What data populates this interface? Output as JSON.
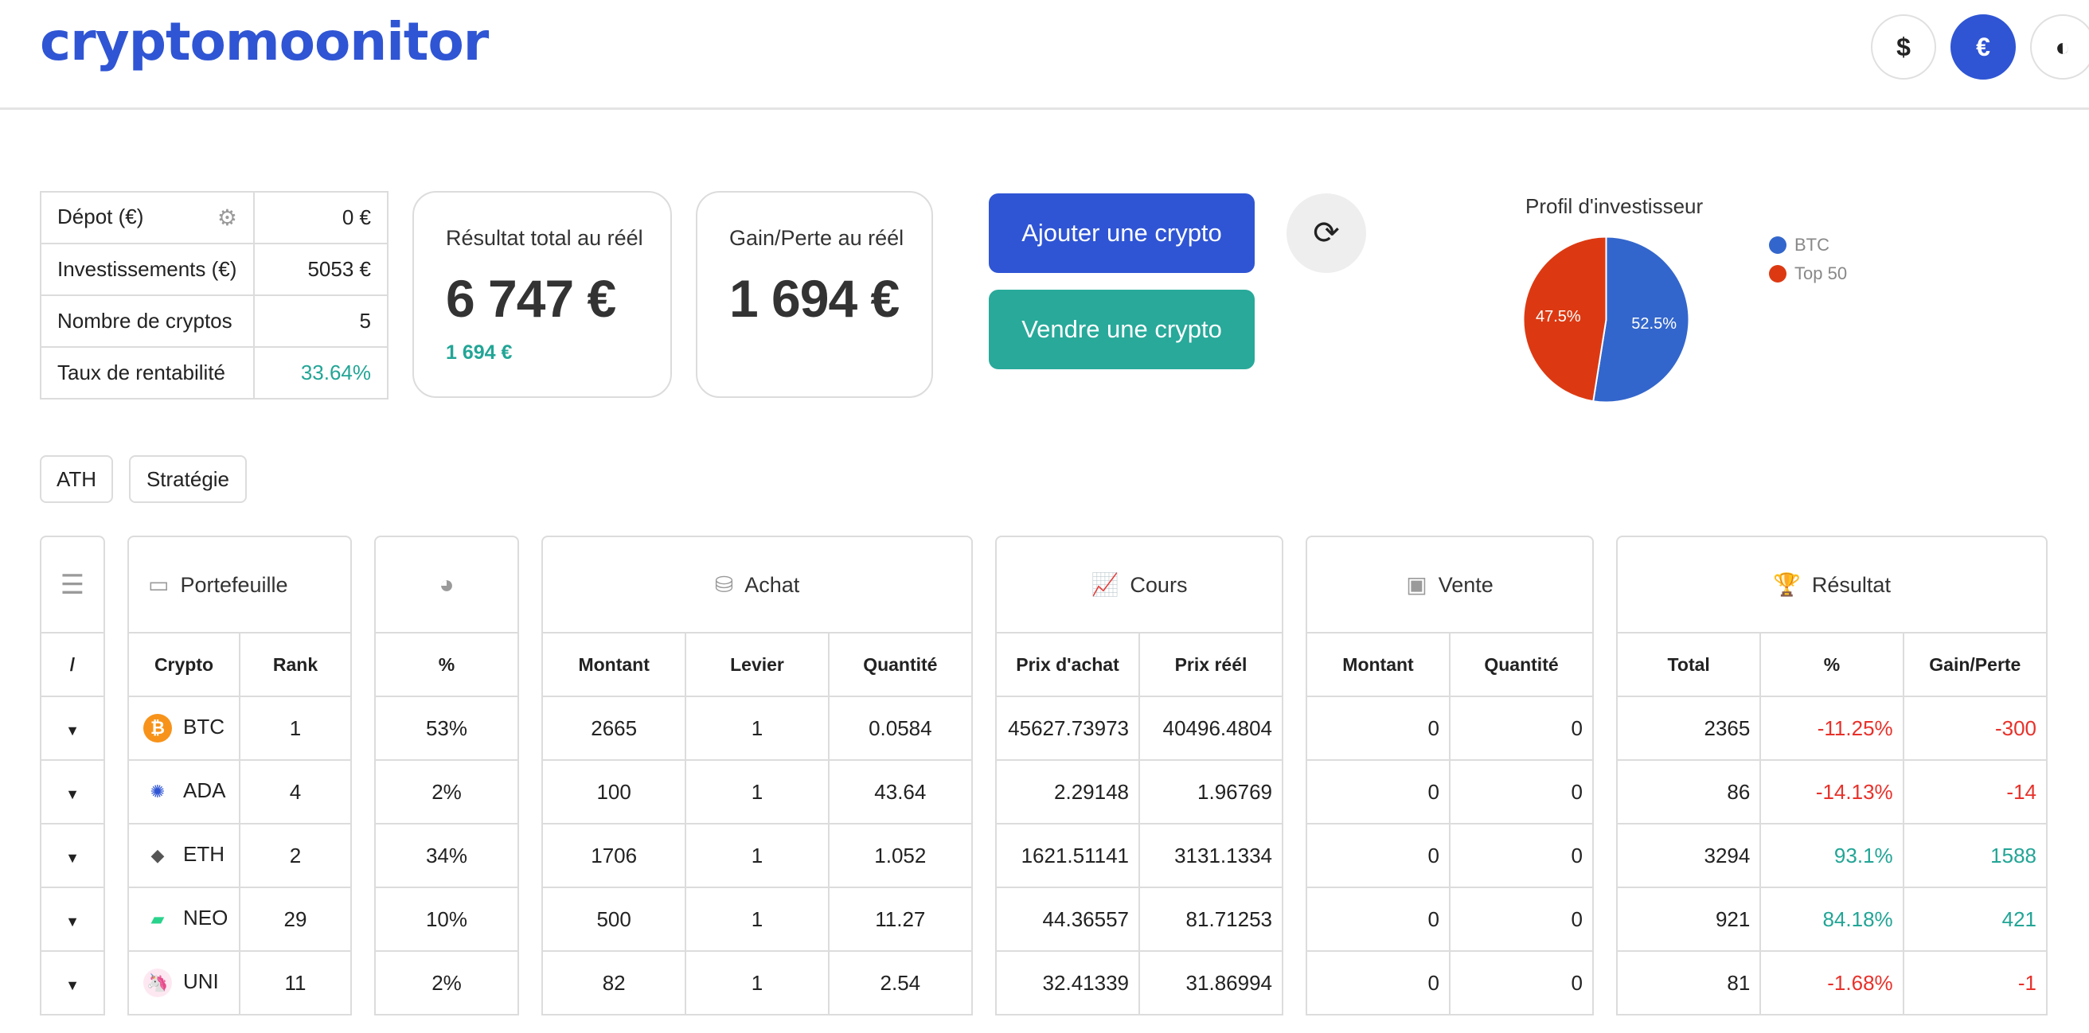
{
  "header": {
    "logo": "cryptomoonitor",
    "currency_buttons": [
      {
        "label": "$",
        "active": false
      },
      {
        "label": "€",
        "active": true
      },
      {
        "label": "◐",
        "active": false
      }
    ]
  },
  "summary": [
    {
      "label": "Dépot (€)",
      "value": "0 €"
    },
    {
      "label": "Investissements (€)",
      "value": "5053 €"
    },
    {
      "label": "Nombre de cryptos",
      "value": "5"
    },
    {
      "label": "Taux de rentabilité",
      "value": "33.64%"
    }
  ],
  "cards": {
    "total": {
      "label": "Résultat total au réél",
      "value": "6 747 €",
      "sub": "1 694 €"
    },
    "gain": {
      "label": "Gain/Perte au réél",
      "value": "1 694 €"
    }
  },
  "actions": {
    "add": "Ajouter une crypto",
    "sell": "Vendre une crypto"
  },
  "profile": {
    "title": "Profil d'investisseur",
    "slices": [
      {
        "name": "BTC",
        "value": 52.5,
        "label": "52.5%",
        "color": "#3366cc"
      },
      {
        "name": "Top 50",
        "value": 47.5,
        "label": "47.5%",
        "color": "#dc3912"
      }
    ]
  },
  "pills": {
    "ath": "ATH",
    "strategy": "Stratégie"
  },
  "groups": {
    "menu": {
      "col": "/"
    },
    "portfolio": {
      "title": "Portefeuille",
      "cols": [
        "Crypto",
        "Rank"
      ]
    },
    "percent": {
      "col": "%"
    },
    "achat": {
      "title": "Achat",
      "cols": [
        "Montant",
        "Levier",
        "Quantité"
      ]
    },
    "cours": {
      "title": "Cours",
      "cols": [
        "Prix d'achat",
        "Prix réél"
      ]
    },
    "vente": {
      "title": "Vente",
      "cols": [
        "Montant",
        "Quantité"
      ]
    },
    "resultat": {
      "title": "Résultat",
      "cols": [
        "Total",
        "%",
        "Gain/Perte"
      ]
    }
  },
  "rows": [
    {
      "crypto": "BTC",
      "rank": "1",
      "pct": "53%",
      "montant": "2665",
      "levier": "1",
      "quantite": "0.0584",
      "prix_achat": "45627.73973",
      "prix_reel": "40496.4804",
      "v_montant": "0",
      "v_quantite": "0",
      "total": "2365",
      "res_pct": "-11.25%",
      "gain": "-300",
      "positive": false,
      "coin_color": "#f7931a",
      "coin_glyph": "₿"
    },
    {
      "crypto": "ADA",
      "rank": "4",
      "pct": "2%",
      "montant": "100",
      "levier": "1",
      "quantite": "43.64",
      "prix_achat": "2.29148",
      "prix_reel": "1.96769",
      "v_montant": "0",
      "v_quantite": "0",
      "total": "86",
      "res_pct": "-14.13%",
      "gain": "-14",
      "positive": false,
      "coin_color": "#ffffff",
      "coin_glyph": "✺"
    },
    {
      "crypto": "ETH",
      "rank": "2",
      "pct": "34%",
      "montant": "1706",
      "levier": "1",
      "quantite": "1.052",
      "prix_achat": "1621.51141",
      "prix_reel": "3131.1334",
      "v_montant": "0",
      "v_quantite": "0",
      "total": "3294",
      "res_pct": "93.1%",
      "gain": "1588",
      "positive": true,
      "coin_color": "#ffffff",
      "coin_glyph": "◆"
    },
    {
      "crypto": "NEO",
      "rank": "29",
      "pct": "10%",
      "montant": "500",
      "levier": "1",
      "quantite": "11.27",
      "prix_achat": "44.36557",
      "prix_reel": "81.71253",
      "v_montant": "0",
      "v_quantite": "0",
      "total": "921",
      "res_pct": "84.18%",
      "gain": "421",
      "positive": true,
      "coin_color": "#ffffff",
      "coin_glyph": "▰"
    },
    {
      "crypto": "UNI",
      "rank": "11",
      "pct": "2%",
      "montant": "82",
      "levier": "1",
      "quantite": "2.54",
      "prix_achat": "32.41339",
      "prix_reel": "31.86994",
      "v_montant": "0",
      "v_quantite": "0",
      "total": "81",
      "res_pct": "-1.68%",
      "gain": "-1",
      "positive": false,
      "coin_color": "#fde8f1",
      "coin_glyph": "🦄"
    }
  ]
}
